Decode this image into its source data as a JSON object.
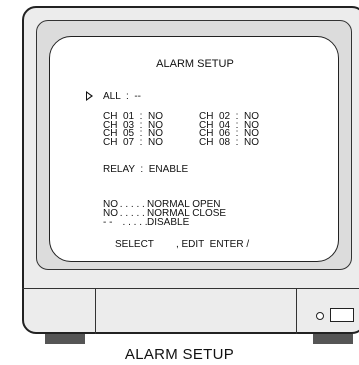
{
  "screen": {
    "title": "ALARM SETUP",
    "all_label": "ALL  :  --",
    "channels": [
      [
        "CH  01  :  NO",
        "CH  02  :  NO"
      ],
      [
        "CH  03  :  NO",
        "CH  04  :  NO"
      ],
      [
        "CH  05  :  NO",
        "CH  06  :  NO"
      ],
      [
        "CH  07  :  NO",
        "CH  08  :  NO"
      ]
    ],
    "relay": "RELAY  :  ENABLE",
    "legend": [
      {
        "code": "NO",
        "dots": " . . . . .",
        "text": "NORMAL OPEN"
      },
      {
        "code": "NO",
        "dots": " . . . . .",
        "text": "NORMAL CLOSE"
      },
      {
        "code": "- -",
        "dots": "  . . . . .",
        "text": "DISABLE"
      }
    ],
    "footer": "SELECT        , EDIT  ENTER /"
  },
  "caption": "ALARM SETUP",
  "icons": {
    "selection_cursor": "triangle-right-icon",
    "power_led": "led-icon",
    "power_button": "power-button-icon"
  }
}
